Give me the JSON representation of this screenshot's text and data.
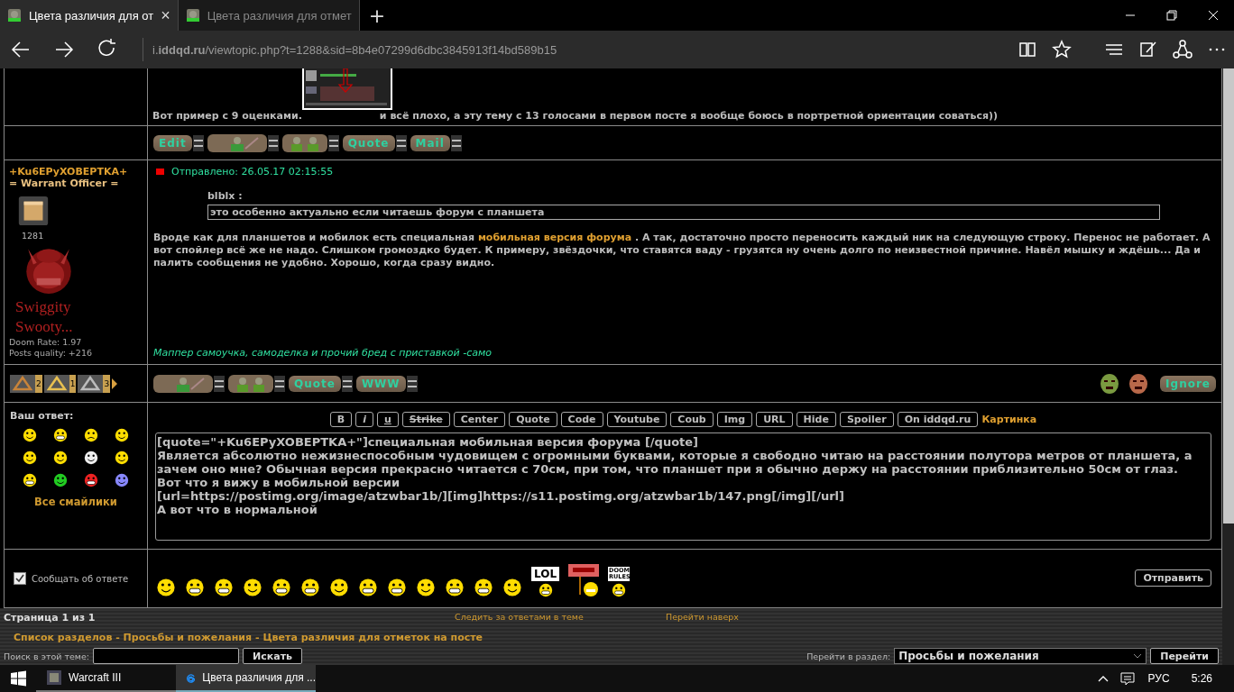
{
  "browser": {
    "tabs": [
      {
        "title": "Цвета различия для от",
        "selected": true
      },
      {
        "title": "Цвета различия для отмет",
        "selected": false
      }
    ],
    "close_glyph": "×",
    "new_tab": "+",
    "url": "i.**iddqd.ru**/viewtopic.php?t=1288&sid=8b4e07299d6dbc3845913f14bd589b15"
  },
  "previous_post": {
    "text_before": "Вот пример с 9 оценками.",
    "text_after": "и всё плохо, а эту тему с 13 голосами в первом посте я вообще боюсь в портретной ориентации соваться))",
    "actions": [
      {
        "kind": "text",
        "label": "Edit"
      },
      {
        "kind": "profile"
      },
      {
        "kind": "pair"
      },
      {
        "kind": "text",
        "label": "Quote"
      },
      {
        "kind": "text",
        "label": "Mail"
      }
    ]
  },
  "post": {
    "author": "+Ku6EPyXOBEPTKA+",
    "rank": "= Warrant Officer =",
    "post_count": "1281",
    "avatar_caption": "Swiggity Swooty...",
    "doom_rate": "Doom Rate: 1.97",
    "posts_quality": "Posts quality: +216",
    "posted": "Отправлено: 26.05.17 02:15:55",
    "quote_author": "blblx :",
    "quote_text": "это особенно актуально если читаешь форум с планшета",
    "body_before": "Вроде как для планшетов и мобилок есть специальная ",
    "body_link": "мобильная версия форума",
    "body_after": " . А так, достаточно просто переносить каждый ник на следующую строку. Перенос не работает. А вот спойлер всё же не надо. Слишком громоздко будет. К примеру, звёздочки, что ставятся ваду - грузятся ну очень долго по неизвестной причине. Навёл мышку и ждёшь... Да и палить сообщения не удобно. Хорошо, когда сразу видно.",
    "signature": "Маппер самоучка, самоделка и прочий бред с приставкой -само",
    "medals": [
      {
        "kind": "bronze",
        "count": "2"
      },
      {
        "kind": "gold",
        "count": "1"
      },
      {
        "kind": "silver",
        "count": "3"
      }
    ],
    "actions": [
      {
        "kind": "profile"
      },
      {
        "kind": "pair"
      },
      {
        "kind": "text",
        "label": "Quote"
      },
      {
        "kind": "text",
        "label": "WWW"
      }
    ],
    "rating": [
      {
        "kind": "green"
      },
      {
        "kind": "red"
      }
    ],
    "ignore": "Ignore"
  },
  "reply": {
    "label": "Ваш ответ:",
    "smilies": [
      {
        "kind": "smile"
      },
      {
        "kind": "grin"
      },
      {
        "kind": "sad"
      },
      {
        "kind": "wink"
      },
      {
        "kind": "crazy"
      },
      {
        "kind": "sly"
      },
      {
        "kind": "skull"
      },
      {
        "kind": "angry"
      },
      {
        "kind": "teeth"
      },
      {
        "kind": "green"
      },
      {
        "kind": "red"
      },
      {
        "kind": "blue"
      }
    ],
    "all_smilies": "Все смайлики",
    "toolbar": [
      {
        "label": "B",
        "kind": "bold"
      },
      {
        "label": "i",
        "kind": "italic"
      },
      {
        "label": "u",
        "kind": "underline"
      },
      {
        "label": "Strike",
        "kind": "strike"
      },
      {
        "label": "Center",
        "kind": "plain"
      },
      {
        "label": "Quote",
        "kind": "plain"
      },
      {
        "label": "Code",
        "kind": "plain"
      },
      {
        "label": "Youtube",
        "kind": "plain"
      },
      {
        "label": "Coub",
        "kind": "plain"
      },
      {
        "label": "Img",
        "kind": "plain"
      },
      {
        "label": "URL",
        "kind": "plain"
      },
      {
        "label": "Hide",
        "kind": "plain"
      },
      {
        "label": "Spoiler",
        "kind": "plain"
      },
      {
        "label": "On iddqd.ru",
        "kind": "plain"
      }
    ],
    "picture_link": "Картинка",
    "message": "[quote=\"+Ku6EPyXOBEPTKA+\"]специальная мобильная версия форума [/quote]\nЯвляется абсолютно нежизнеспособным чудовищем с огромными буквами, которые я свободно читаю на расстоянии полутора метров от планшета, а зачем оно мне? Обычная версия прекрасно читается с 70см, при том, что планшет при я обычно держу на расстоянии приблизительно 50см от глаз.\nВот что я вижу в мобильной версии\n[url=https://postimg.org/image/atzwbar1b/][img]https://s11.postimg.org/atzwbar1b/147.png[/img][/url]\nА вот что в нормальной",
    "notify": {
      "label": "Сообщать об ответе",
      "checked": true
    },
    "extra_smilies": [
      {
        "kind": "smiley"
      },
      {
        "kind": "smiley"
      },
      {
        "kind": "smiley"
      },
      {
        "kind": "smiley"
      },
      {
        "kind": "smiley"
      },
      {
        "kind": "smiley"
      },
      {
        "kind": "smiley"
      },
      {
        "kind": "smiley"
      },
      {
        "kind": "smiley"
      },
      {
        "kind": "smiley"
      },
      {
        "kind": "smiley"
      },
      {
        "kind": "smiley"
      },
      {
        "kind": "smiley"
      },
      {
        "kind": "sign",
        "sign": "LOL"
      },
      {
        "kind": "red_sign"
      },
      {
        "kind": "sign",
        "sign": "DOOM RULES"
      }
    ],
    "submit": "Отправить"
  },
  "footer": {
    "page": "Страница 1 из 1",
    "watch": "Следить за ответами в теме",
    "to_top": "Перейти наверх",
    "breadcrumb": [
      "Список разделов",
      "Просьбы и пожелания",
      "Цвета различия для отметок на посте"
    ],
    "separator": " - ",
    "search_label": "Поиск в этой теме:",
    "search_button": "Искать",
    "jump_label": "Перейти в раздел:",
    "jump_value": "Просьбы и пожелания",
    "jump_button": "Перейти"
  },
  "taskbar": {
    "apps": [
      {
        "kind": "game",
        "label": "Warcraft III",
        "selected": false
      },
      {
        "kind": "browser",
        "label": "Цвета различия для ...",
        "selected": true
      }
    ],
    "language": "РУС",
    "time": "5:26"
  }
}
